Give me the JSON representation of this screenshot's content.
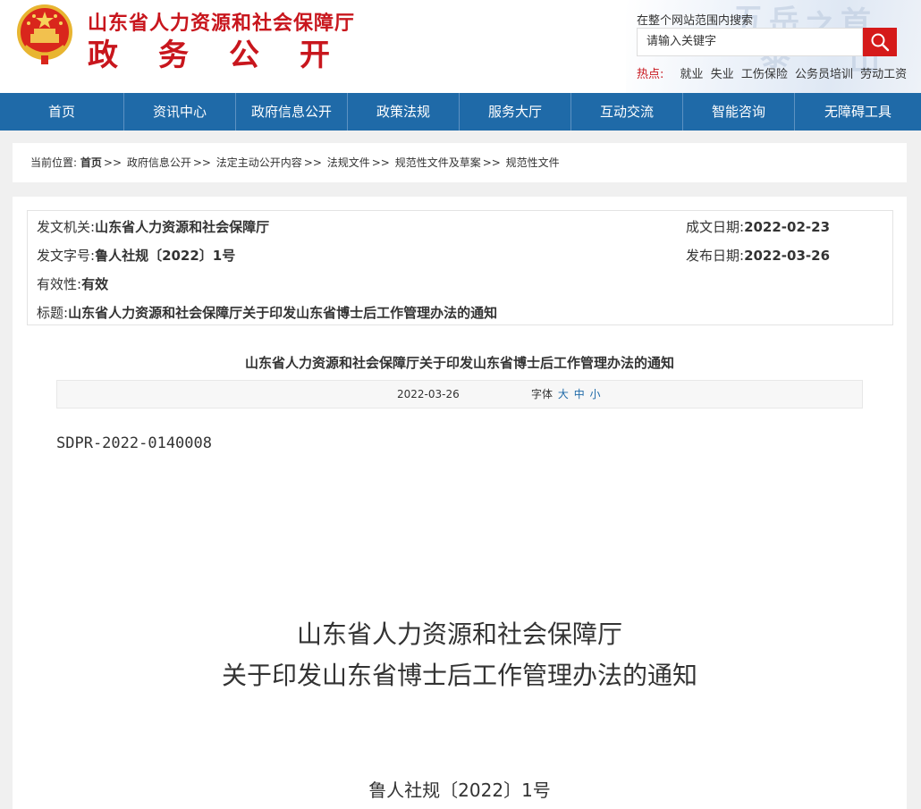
{
  "header": {
    "site_title": "山东省人力资源和社会保障厅",
    "site_subtitle": "政务公开",
    "search_hint": "在整个网站范围内搜索",
    "search_placeholder": "请输入关键字",
    "hot_label": "热点:",
    "hot_links": [
      "就业",
      "失业",
      "工伤保险",
      "公务员培训",
      "劳动工资"
    ],
    "colors": {
      "brand_red": "#c8161d",
      "search_button": "#d51a1a"
    }
  },
  "nav": {
    "items": [
      "首页",
      "资讯中心",
      "政府信息公开",
      "政策法规",
      "服务大厅",
      "互动交流",
      "智能咨询",
      "无障碍工具"
    ],
    "color": "#1f6aa8"
  },
  "breadcrumb": {
    "prefix": "当前位置:",
    "items": [
      "首页",
      "政府信息公开",
      "法定主动公开内容",
      "法规文件",
      "规范性文件及草案",
      "规范性文件"
    ],
    "separator": ">>"
  },
  "meta": {
    "issuer_label": "发文机关:",
    "issuer": "山东省人力资源和社会保障厅",
    "docno_label": "发文字号:",
    "docno": "鲁人社规〔2022〕1号",
    "validity_label": "有效性:",
    "validity": "有效",
    "title_label": "标题:",
    "title": "山东省人力资源和社会保障厅关于印发山东省博士后工作管理办法的通知",
    "created_label": "成文日期:",
    "created": "2022-02-23",
    "published_label": "发布日期:",
    "published": "2022-03-26"
  },
  "article": {
    "title": "山东省人力资源和社会保障厅关于印发山东省博士后工作管理办法的通知",
    "date": "2022-03-26",
    "font_label": "字体",
    "font_sizes": [
      "大",
      "中",
      "小"
    ],
    "doc_id": "SDPR-2022-0140008",
    "heading_line1": "山东省人力资源和社会保障厅",
    "heading_line2": "关于印发山东省博士后工作管理办法的通知",
    "doc_ref": "鲁人社规〔2022〕1号"
  }
}
